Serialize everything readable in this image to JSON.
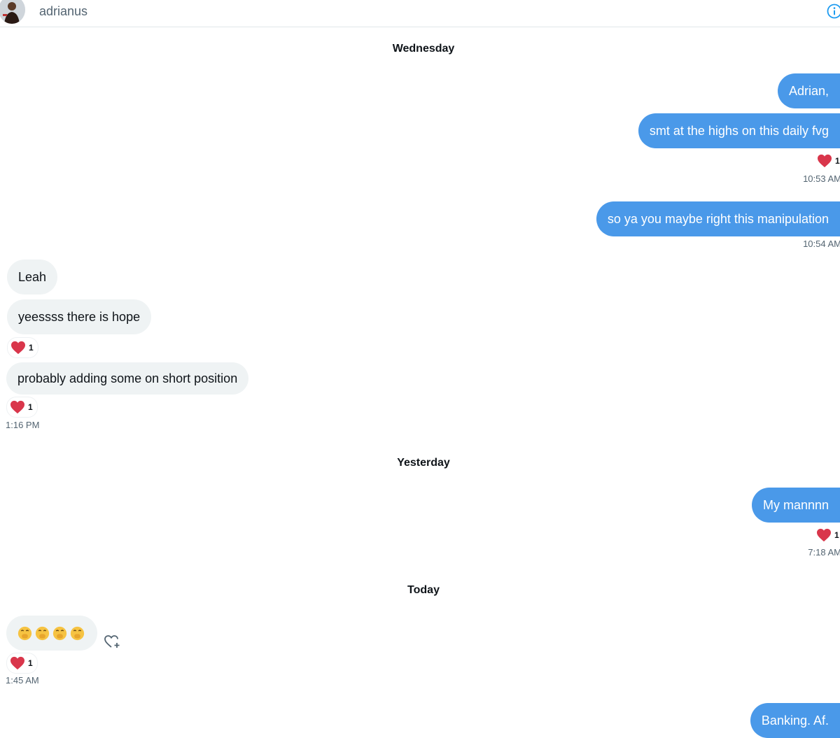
{
  "header": {
    "contact_name": "adrianus"
  },
  "days": {
    "wednesday": "Wednesday",
    "yesterday": "Yesterday",
    "today": "Today"
  },
  "messages": {
    "m1": "Adrian,",
    "m2": "smt at the highs on this daily fvg",
    "m2_react_count": "1",
    "m2_time": "10:53 AM",
    "m3": "so ya you maybe right this manipulation",
    "m3_time": "10:54 AM",
    "m4": "Leah",
    "m5": "yeessss there is hope",
    "m5_react_count": "1",
    "m6": "probably adding some on short position",
    "m6_react_count": "1",
    "m6_time": "1:16 PM",
    "m7": "My mannnn",
    "m7_react_count": "1",
    "m7_time": "7:18 AM",
    "m8_react_count": "1",
    "m8_time": "1:45 AM",
    "m9": "Banking. Af."
  },
  "colors": {
    "accent": "#4a99e9",
    "incoming_bubble": "#eff3f4",
    "heart": "#e0245e"
  },
  "icons": {
    "info": "info-icon",
    "heart": "heart-icon",
    "add_reaction": "add-reaction-icon",
    "emoji": "hand-over-mouth-emoji"
  }
}
